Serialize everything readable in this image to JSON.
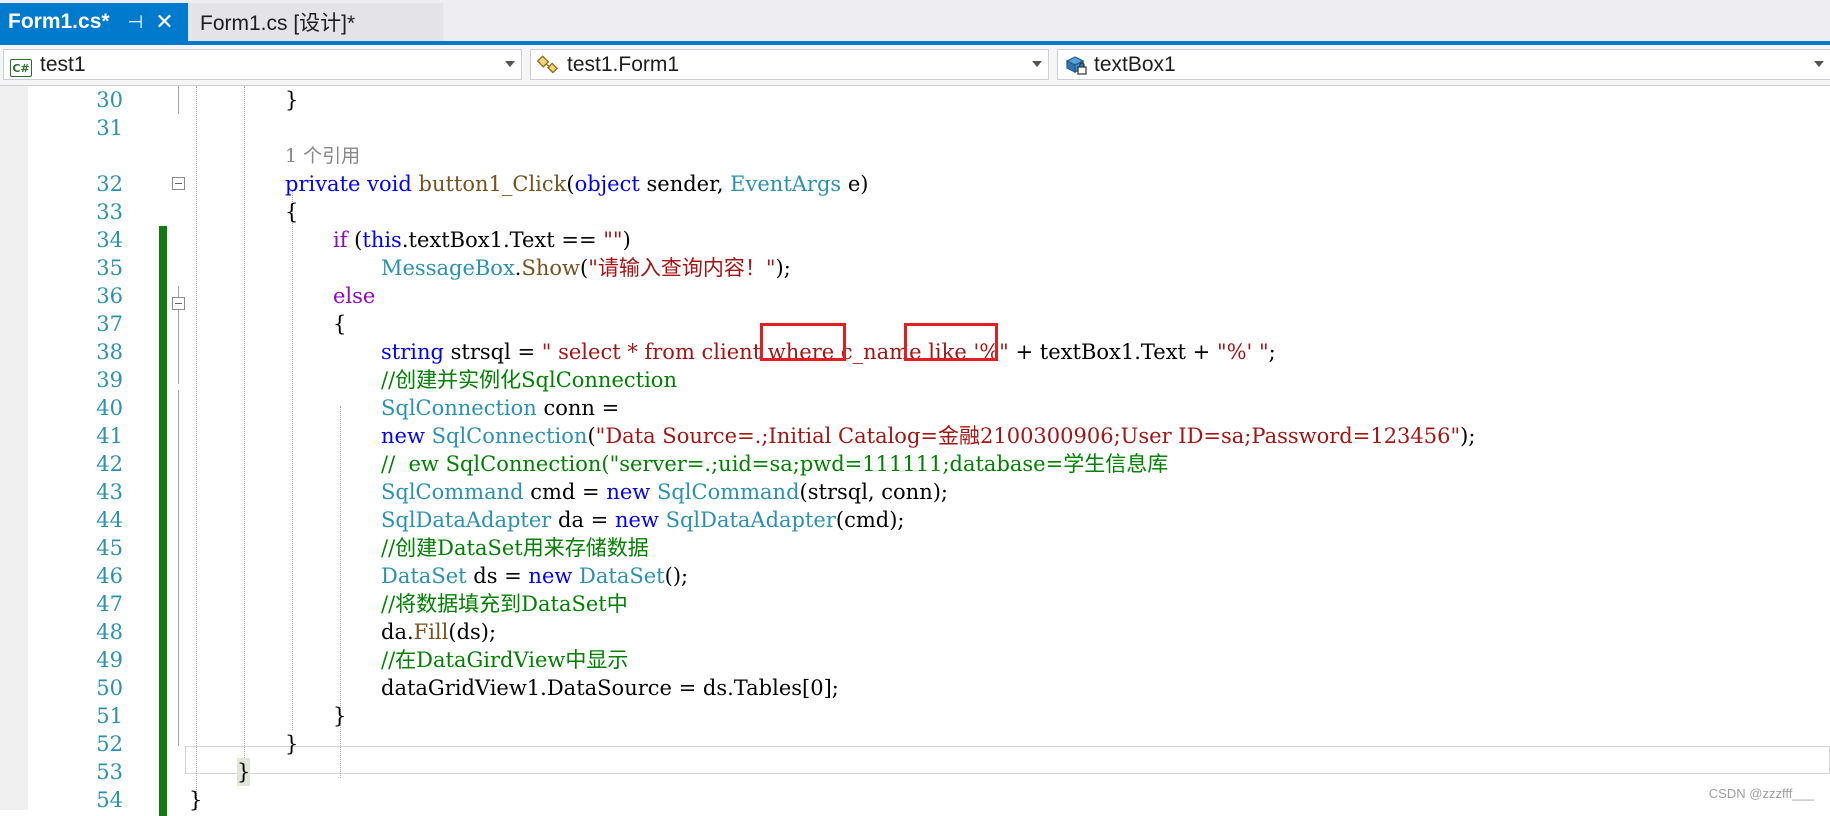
{
  "tabs": [
    {
      "label": "Form1.cs*",
      "pin": "⊣",
      "close": "✕",
      "active": true
    },
    {
      "label": "Form1.cs [设计]*",
      "active": false
    }
  ],
  "navbar": {
    "project": "test1",
    "class": "test1.Form1",
    "member": "textBox1",
    "project_icon": "csharp-project-icon",
    "class_icon": "class-icon",
    "member_icon": "field-icon"
  },
  "code_lines": [
    {
      "num": "30",
      "text": "}"
    },
    {
      "num": "31",
      "text": ""
    },
    {
      "num": "",
      "text": "1 个引用"
    },
    {
      "num": "32",
      "text": "private void button1_Click(object sender, EventArgs e)"
    },
    {
      "num": "33",
      "text": "{"
    },
    {
      "num": "34",
      "text": "if (this.textBox1.Text == \"\")"
    },
    {
      "num": "35",
      "text": "MessageBox.Show(\"请输入查询内容！\");"
    },
    {
      "num": "36",
      "text": "else"
    },
    {
      "num": "37",
      "text": "{"
    },
    {
      "num": "38",
      "text": "string strsql = \" select * from client where c_name like '%\" + textBox1.Text + \"%' \";"
    },
    {
      "num": "39",
      "text": "//创建并实例化SqlConnection"
    },
    {
      "num": "40",
      "text": "SqlConnection conn ="
    },
    {
      "num": "41",
      "text": "new SqlConnection(\"Data Source=.;Initial Catalog=金融2100300906;User ID=sa;Password=123456\");"
    },
    {
      "num": "42",
      "text": "//  ew SqlConnection(\"server=.;uid=sa;pwd=111111;database=学生信息库"
    },
    {
      "num": "43",
      "text": "SqlCommand cmd = new SqlCommand(strsql, conn);"
    },
    {
      "num": "44",
      "text": "SqlDataAdapter da = new SqlDataAdapter(cmd);"
    },
    {
      "num": "45",
      "text": "//创建DataSet用来存储数据"
    },
    {
      "num": "46",
      "text": "DataSet ds = new DataSet();"
    },
    {
      "num": "47",
      "text": "//将数据填充到DataSet中"
    },
    {
      "num": "48",
      "text": "da.Fill(ds);"
    },
    {
      "num": "49",
      "text": "//在DataGirdView中显示"
    },
    {
      "num": "50",
      "text": "dataGridView1.DataSource = ds.Tables[0];"
    },
    {
      "num": "51",
      "text": "}"
    },
    {
      "num": "52",
      "text": "}"
    },
    {
      "num": "53",
      "text": "}"
    },
    {
      "num": "54",
      "text": "}"
    }
  ],
  "watermark": "CSDN @zzzfff___",
  "colors": {
    "accent": "#007acc",
    "keyword": "#0000ff",
    "control_keyword": "#8f08c4",
    "type": "#2b91af",
    "string": "#a31515",
    "comment": "#008000",
    "change_bar": "#107c10",
    "highlight_box": "#e02020"
  }
}
